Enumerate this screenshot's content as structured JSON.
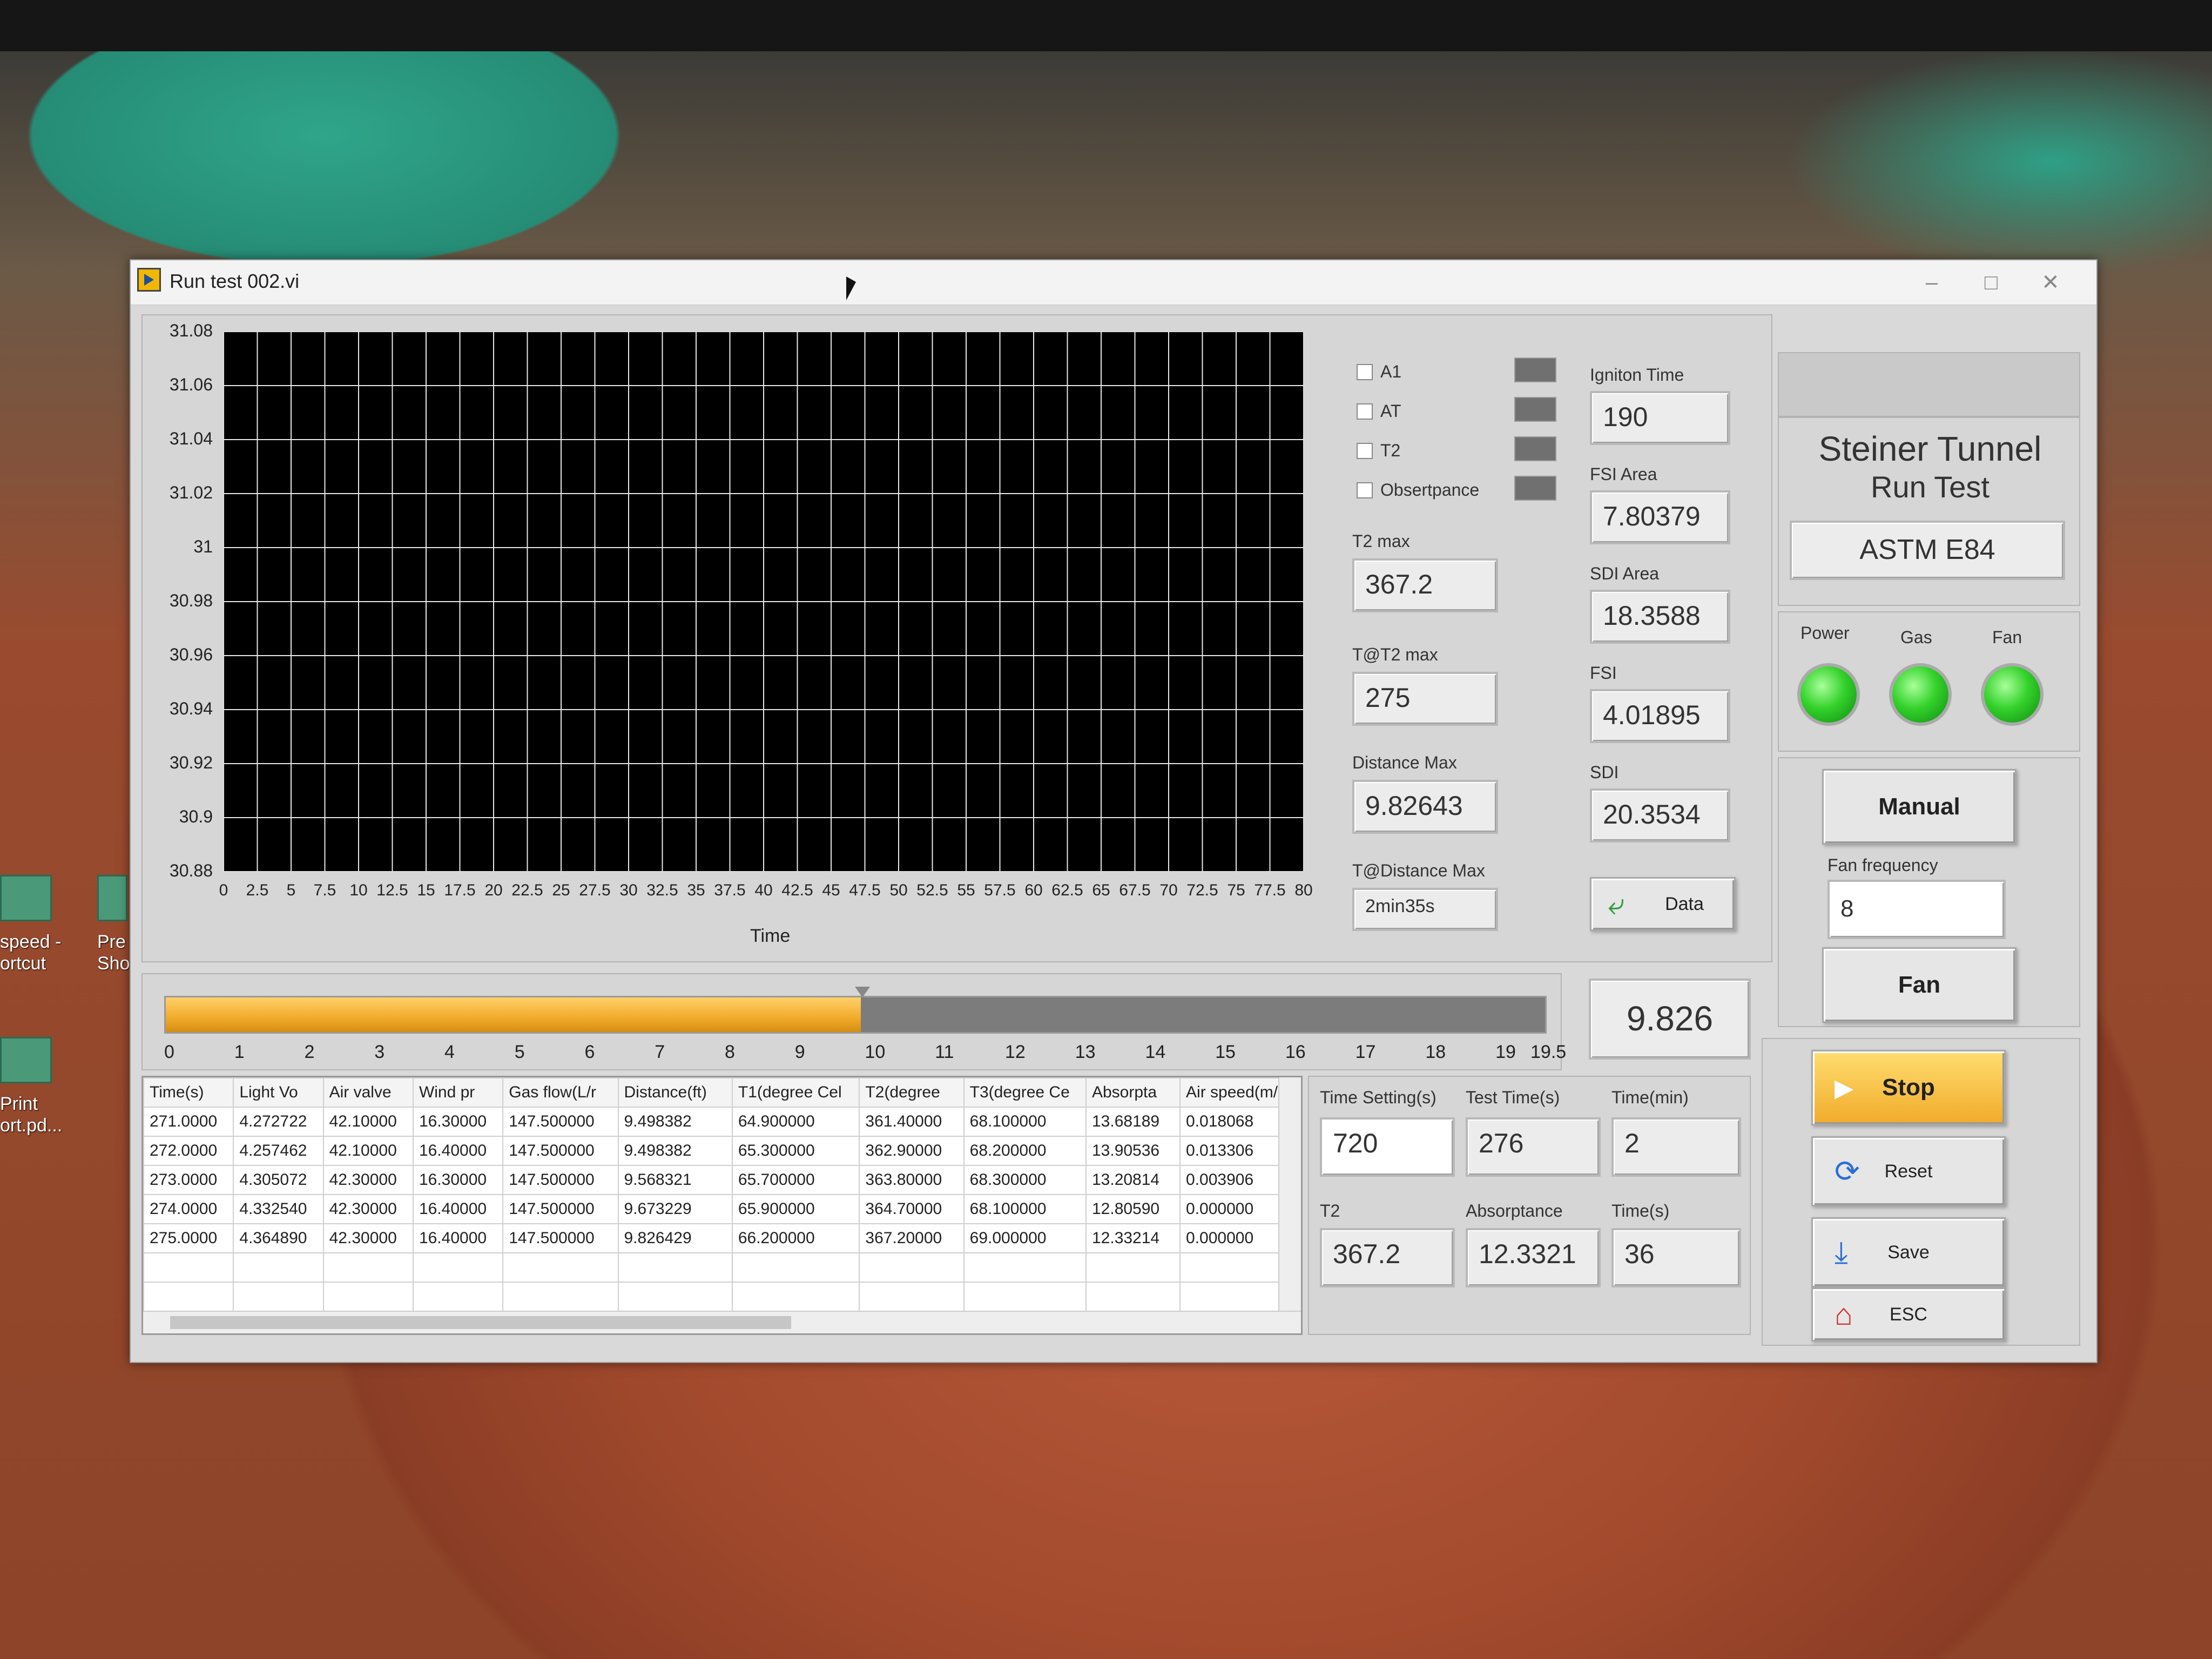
{
  "window": {
    "title": "Run test 002.vi"
  },
  "desktop": {
    "icons": [
      {
        "label1": "speed -",
        "label2": "ortcut"
      },
      {
        "label1": "Pre",
        "label2": "Sho"
      },
      {
        "label1": "Print",
        "label2": "ort.pd..."
      }
    ]
  },
  "chart_data": {
    "type": "line",
    "xlabel": "Time",
    "ylabel": "",
    "xlim": [
      0,
      80
    ],
    "ylim": [
      30.88,
      31.08
    ],
    "x_ticks": [
      "0",
      "2.5",
      "5",
      "7.5",
      "10",
      "12.5",
      "15",
      "17.5",
      "20",
      "22.5",
      "25",
      "27.5",
      "30",
      "32.5",
      "35",
      "37.5",
      "40",
      "42.5",
      "45",
      "47.5",
      "50",
      "52.5",
      "55",
      "57.5",
      "60",
      "62.5",
      "65",
      "67.5",
      "70",
      "72.5",
      "75",
      "77.5",
      "80"
    ],
    "y_ticks": [
      "31.08",
      "31.06",
      "31.04",
      "31.02",
      "31",
      "30.98",
      "30.96",
      "30.94",
      "30.92",
      "30.9",
      "30.88"
    ],
    "grid": true,
    "series": []
  },
  "legend": {
    "items": [
      "A1",
      "AT",
      "T2",
      "Obsertpance"
    ]
  },
  "stats": {
    "ignition_time_label": "Igniton Time",
    "ignition_time": "190",
    "fsi_area_label": "FSI Area",
    "fsi_area": "7.80379",
    "sdi_area_label": "SDI Area",
    "sdi_area": "18.3588",
    "fsi_label": "FSI",
    "fsi": "4.01895",
    "sdi_label": "SDI",
    "sdi": "20.3534",
    "t2max_label": "T2 max",
    "t2max": "367.2",
    "t_at_t2max_label": "T@T2 max",
    "t_at_t2max": "275",
    "distance_max_label": "Distance Max",
    "distance_max": "9.82643",
    "t_at_distance_max_label": "T@Distance Max",
    "t_at_distance_max": "2min35s",
    "data_button": "Data"
  },
  "header": {
    "line1": "Steiner Tunnel",
    "line2": "Run Test",
    "standard": "ASTM E84"
  },
  "indicators": {
    "power": "Power",
    "gas": "Gas",
    "fan": "Fan"
  },
  "controls": {
    "manual": "Manual",
    "fan_frequency_label": "Fan frequency",
    "fan_frequency": "8",
    "fan": "Fan",
    "stop": "Stop",
    "reset": "Reset",
    "save": "Save",
    "esc": "ESC"
  },
  "slider": {
    "value": 9.826,
    "max": 19.5,
    "display": "9.826",
    "ticks": [
      "0",
      "1",
      "2",
      "3",
      "4",
      "5",
      "6",
      "7",
      "8",
      "9",
      "10",
      "11",
      "12",
      "13",
      "14",
      "15",
      "16",
      "17",
      "18",
      "19",
      "19.5"
    ]
  },
  "table": {
    "headers": [
      "Time(s)",
      "Light Vo",
      "Air valve",
      "Wind pr",
      "Gas flow(L/r",
      "Distance(ft)",
      "T1(degree Cel",
      "T2(degree",
      "T3(degree Ce",
      "Absorpta",
      "Air speed(m/"
    ],
    "rows": [
      [
        "271.0000",
        "4.272722",
        "42.10000",
        "16.30000",
        "147.500000",
        "9.498382",
        "64.900000",
        "361.40000",
        "68.100000",
        "13.68189",
        "0.018068"
      ],
      [
        "272.0000",
        "4.257462",
        "42.10000",
        "16.40000",
        "147.500000",
        "9.498382",
        "65.300000",
        "362.90000",
        "68.200000",
        "13.90536",
        "0.013306"
      ],
      [
        "273.0000",
        "4.305072",
        "42.30000",
        "16.30000",
        "147.500000",
        "9.568321",
        "65.700000",
        "363.80000",
        "68.300000",
        "13.20814",
        "0.003906"
      ],
      [
        "274.0000",
        "4.332540",
        "42.30000",
        "16.40000",
        "147.500000",
        "9.673229",
        "65.900000",
        "364.70000",
        "68.100000",
        "12.80590",
        "0.000000"
      ],
      [
        "275.0000",
        "4.364890",
        "42.30000",
        "16.40000",
        "147.500000",
        "9.826429",
        "66.200000",
        "367.20000",
        "69.000000",
        "12.33214",
        "0.000000"
      ]
    ]
  },
  "timing": {
    "time_setting_label": "Time Setting(s)",
    "time_setting": "720",
    "test_time_label": "Test Time(s)",
    "test_time": "276",
    "time_min_label": "Time(min)",
    "time_min": "2",
    "t2_label": "T2",
    "t2": "367.2",
    "absorptance_label": "Absorptance",
    "absorptance": "12.3321",
    "time_s_label": "Time(s)",
    "time_s": "36"
  },
  "colors": {
    "accent_orange": "#f1ab2a",
    "led_green": "#34d22b",
    "plot_bg": "#000000"
  }
}
